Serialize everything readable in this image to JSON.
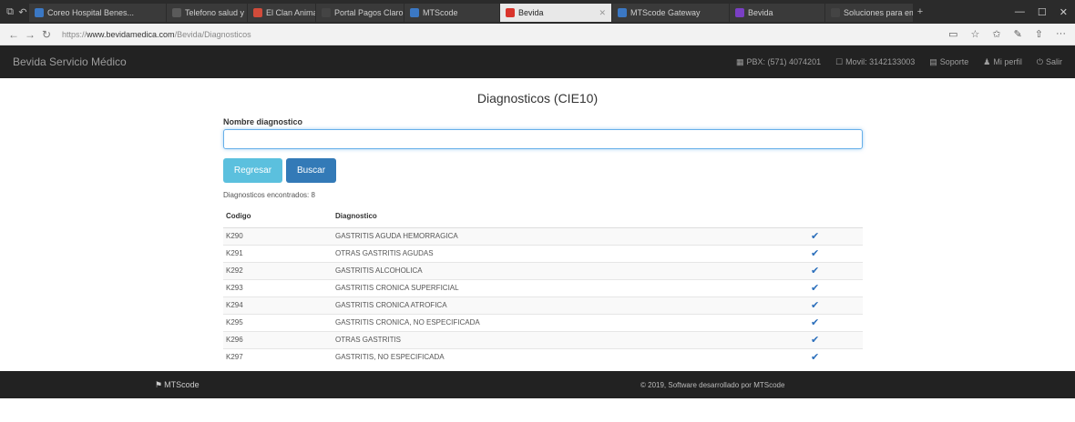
{
  "browser": {
    "tabs": [
      {
        "label": "Coreo Hospital Benes...",
        "color": "#3b78c4",
        "active": false
      },
      {
        "label": "Telefono salud y ba...",
        "color": "#5a5a5a",
        "active": false
      },
      {
        "label": "El Clan Animal",
        "color": "#d14b3a",
        "active": false
      },
      {
        "label": "Portal Pagos Claro",
        "color": "#444444",
        "active": false
      },
      {
        "label": "MTScode",
        "color": "#3b78c4",
        "active": false
      },
      {
        "label": "Bevida",
        "color": "#d9342b",
        "active": true
      },
      {
        "label": "MTScode Gateway",
        "color": "#3b78c4",
        "active": false
      },
      {
        "label": "Bevida",
        "color": "#7a3fc4",
        "active": false
      },
      {
        "label": "Soluciones para empresa",
        "color": "#444444",
        "active": false
      }
    ],
    "url_prefix": "https://",
    "url_host": "www.bevidamedica.com",
    "url_path": "/Bevida/Diagnosticos"
  },
  "navbar": {
    "brand": "Bevida Servicio Médico",
    "items": [
      {
        "icon": "▦",
        "label": "PBX: (571) 4074201"
      },
      {
        "icon": "☐",
        "label": "Movil: 3142133003"
      },
      {
        "icon": "▤",
        "label": "Soporte"
      },
      {
        "icon": "♟",
        "label": "Mi perfil"
      },
      {
        "icon": "⏻",
        "label": "Salir"
      }
    ]
  },
  "main": {
    "title": "Diagnosticos (CIE10)",
    "field_label": "Nombre diagnostico",
    "search_value": "",
    "search_placeholder": "",
    "back_label": "Regresar",
    "search_label": "Buscar",
    "found_text": "Diagnosticos encontrados: 8",
    "table": {
      "headers": [
        "Codigo",
        "Diagnostico",
        ""
      ],
      "rows": [
        {
          "code": "K290",
          "name": "GASTRITIS AGUDA HEMORRAGICA"
        },
        {
          "code": "K291",
          "name": "OTRAS GASTRITIS AGUDAS"
        },
        {
          "code": "K292",
          "name": "GASTRITIS ALCOHOLICA"
        },
        {
          "code": "K293",
          "name": "GASTRITIS CRONICA SUPERFICIAL"
        },
        {
          "code": "K294",
          "name": "GASTRITIS CRONICA ATROFICA"
        },
        {
          "code": "K295",
          "name": "GASTRITIS CRONICA, NO ESPECIFICADA"
        },
        {
          "code": "K296",
          "name": "OTRAS GASTRITIS"
        },
        {
          "code": "K297",
          "name": "GASTRITIS, NO ESPECIFICADA"
        }
      ],
      "check_symbol": "✔"
    }
  },
  "footer": {
    "logo": "MTScode",
    "copyright": "© 2019, Software desarrollado por MTScode"
  },
  "colors": {
    "navbar_bg": "#222222",
    "btn_info": "#5bc0de",
    "btn_primary": "#337ab7"
  }
}
